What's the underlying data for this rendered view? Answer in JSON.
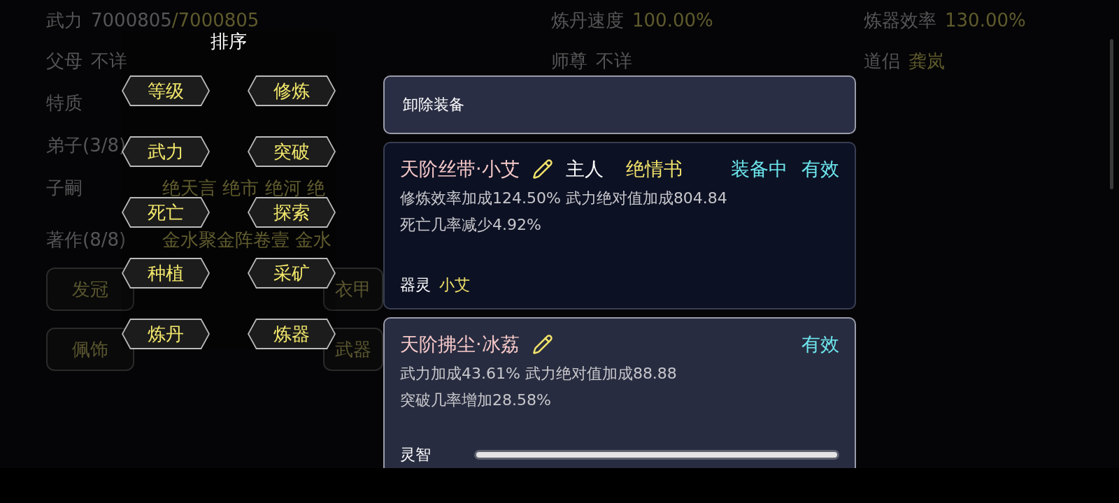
{
  "background": {
    "top_rows": [
      {
        "cells": [
          {
            "label": "武力",
            "value": "7000805",
            "extra": "/7000805",
            "highlight": false
          },
          {
            "label": "炼丹速度",
            "value": "100.00%",
            "highlight": true
          },
          {
            "label": "炼器效率",
            "value": "130.00%",
            "highlight": true
          }
        ]
      },
      {
        "cells": [
          {
            "label": "父母",
            "value": "不详",
            "highlight": false
          },
          {
            "label": "师尊",
            "value": "不详",
            "highlight": false
          },
          {
            "label": "道侣",
            "value": "龚岚",
            "highlight": true
          }
        ]
      }
    ],
    "rows": [
      {
        "label": "特质"
      },
      {
        "label": "弟子(3/8)"
      },
      {
        "label": "子嗣",
        "value": "绝天言 绝市 绝河 绝"
      },
      {
        "label": "著作(8/8)",
        "value": "金水聚金阵卷壹 金水"
      }
    ],
    "slots": [
      {
        "left": "发冠",
        "right": "衣甲"
      },
      {
        "left": "佩饰",
        "right": "武器"
      }
    ]
  },
  "sort_menu": {
    "title": "排序",
    "options": [
      {
        "label": "等级"
      },
      {
        "label": "修炼"
      },
      {
        "label": "武力"
      },
      {
        "label": "突破"
      },
      {
        "label": "死亡"
      },
      {
        "label": "探索"
      },
      {
        "label": "种植"
      },
      {
        "label": "采矿"
      },
      {
        "label": "炼丹"
      },
      {
        "label": "炼器"
      }
    ]
  },
  "equipment": [
    {
      "kind": "action",
      "label": "卸除装备"
    },
    {
      "kind": "item",
      "highlighted": false,
      "name": "天阶丝带·小艾",
      "owner_label": "主人",
      "owner": "绝情书",
      "equipped_label": "装备中",
      "status": "有效",
      "effects": [
        "修炼效率加成124.50% 武力绝对值加成804.84",
        "死亡几率减少4.92%"
      ],
      "spirit": {
        "label": "器灵",
        "value": "小艾"
      }
    },
    {
      "kind": "item",
      "highlighted": true,
      "name": "天阶拂尘·冰荔",
      "status": "有效",
      "effects": [
        "武力加成43.61% 武力绝对值加成88.88",
        "突破几率增加28.58%"
      ],
      "intellect": {
        "label": "灵智",
        "level": 1
      }
    }
  ]
}
